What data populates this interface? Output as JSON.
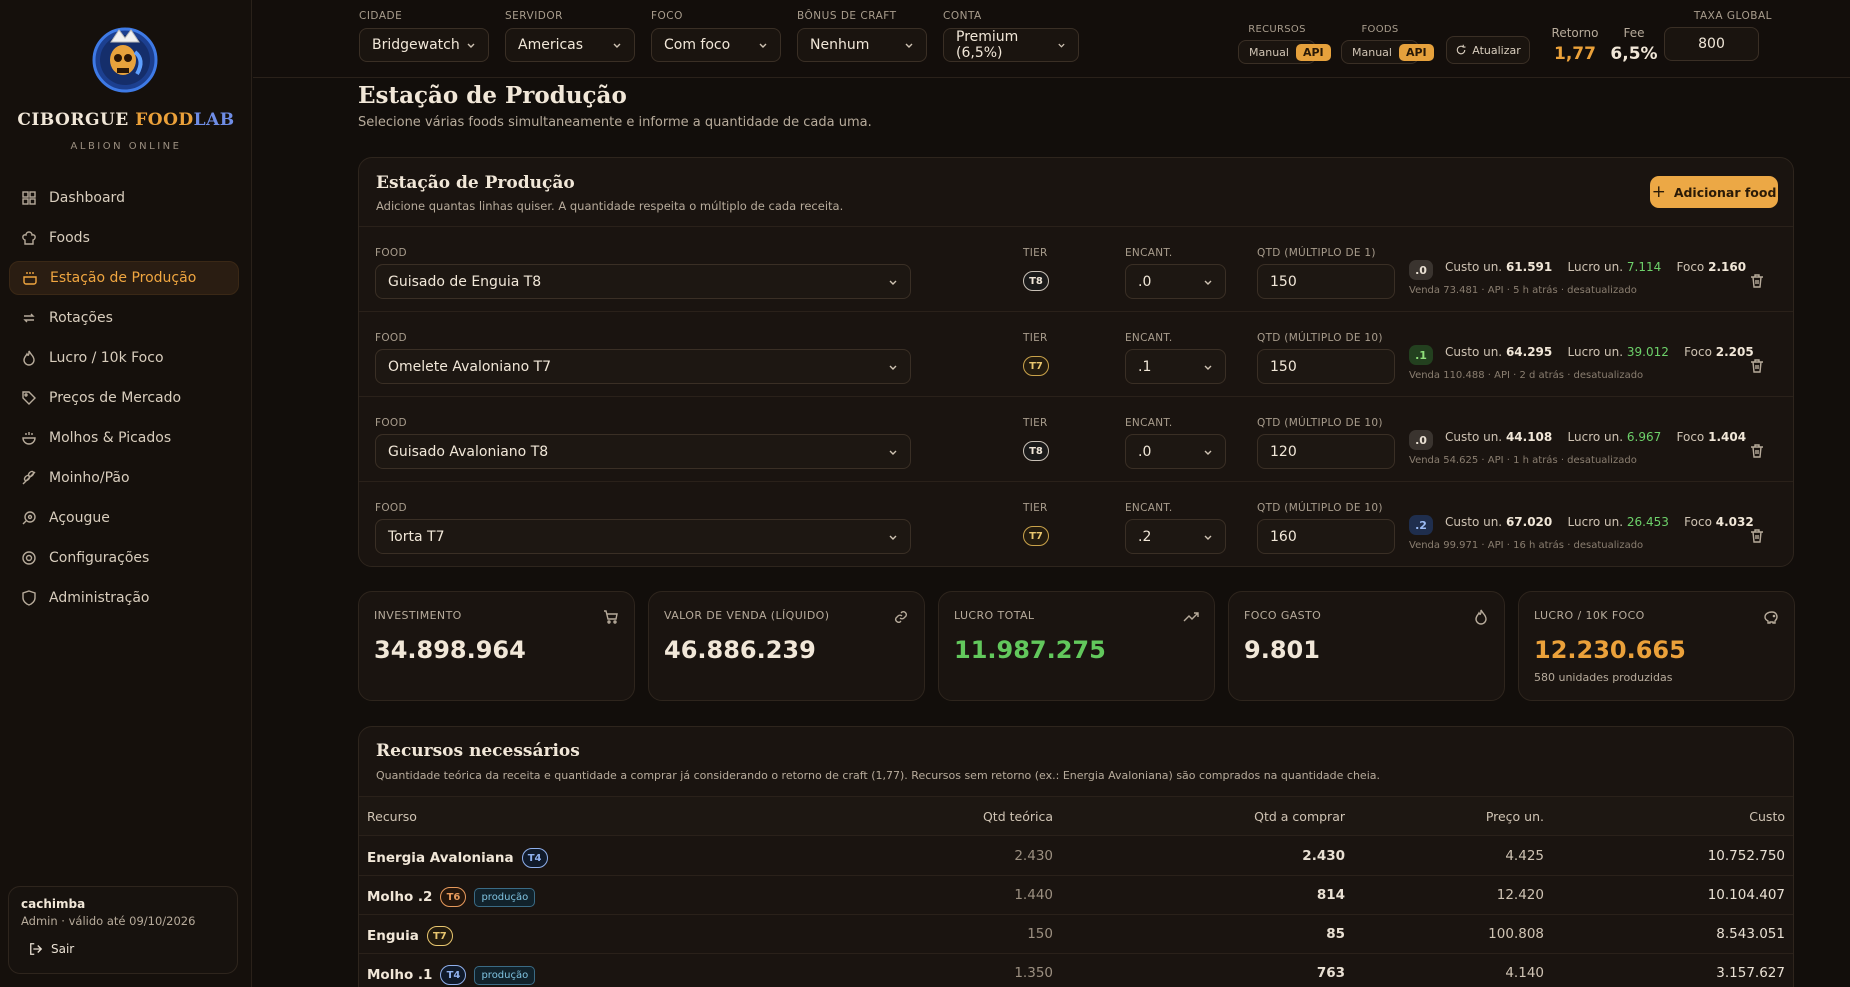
{
  "brand": {
    "name_a": "CIBORGUE ",
    "name_b": "FOOD",
    "name_c": "LAB",
    "sub": "ALBION ONLINE"
  },
  "nav": [
    {
      "label": "Dashboard",
      "icon": "grid-icon"
    },
    {
      "label": "Foods",
      "icon": "chef-hat-icon"
    },
    {
      "label": "Estação de Produção",
      "icon": "cooking-pot-icon",
      "active": true
    },
    {
      "label": "Rotações",
      "icon": "repeat-icon"
    },
    {
      "label": "Lucro / 10k Foco",
      "icon": "flame-icon"
    },
    {
      "label": "Preços de Mercado",
      "icon": "tag-icon"
    },
    {
      "label": "Molhos & Picados",
      "icon": "soup-icon"
    },
    {
      "label": "Moinho/Pão",
      "icon": "wheat-icon"
    },
    {
      "label": "Açougue",
      "icon": "beef-icon"
    },
    {
      "label": "Configurações",
      "icon": "settings-icon"
    },
    {
      "label": "Administração",
      "icon": "shield-icon"
    }
  ],
  "user": {
    "name": "cachimba",
    "role": "Admin · válido até 09/10/2026",
    "logout": "Sair"
  },
  "filters": {
    "cidade": {
      "label": "CIDADE",
      "value": "Bridgewatch"
    },
    "servidor": {
      "label": "SERVIDOR",
      "value": "Americas"
    },
    "foco": {
      "label": "FOCO",
      "value": "Com foco"
    },
    "bonus": {
      "label": "BÔNUS DE CRAFT",
      "value": "Nenhum"
    },
    "conta": {
      "label": "CONTA",
      "value": "Premium (6,5%)"
    }
  },
  "toggles": {
    "recursos": {
      "label": "RECURSOS",
      "manual": "Manual",
      "api": "API"
    },
    "foods": {
      "label": "FOODS",
      "manual": "Manual",
      "api": "API"
    }
  },
  "refresh_label": "Atualizar",
  "stats": {
    "retorno": {
      "label": "Retorno",
      "value": "1,77"
    },
    "fee": {
      "label": "Fee",
      "value": "6,5%"
    }
  },
  "taxa": {
    "label": "TAXA GLOBAL",
    "value": "800"
  },
  "page": {
    "title": "Estação de Produção",
    "subtitle": "Selecione várias foods simultaneamente e informe a quantidade de cada uma."
  },
  "station": {
    "title": "Estação de Produção",
    "subtitle": "Adicione quantas linhas quiser. A quantidade respeita o múltiplo de cada receita.",
    "add_label": "Adicionar food",
    "col_food": "FOOD",
    "col_tier": "TIER",
    "col_ench": "ENCANT.",
    "rows": [
      {
        "food": "Guisado de Enguia T8",
        "tier": "T8",
        "ench": ".0",
        "qtd_label": "QTD (MÚLTIPLO DE 1)",
        "qtd": "150",
        "chip": ".0",
        "custo_lbl": "Custo un.",
        "custo": "61.591",
        "lucro_lbl": "Lucro un.",
        "lucro": "7.114",
        "foco_lbl": "Foco",
        "foco": "2.160",
        "sub": "Venda 73.481 · API · 5 h atrás · desatualizado"
      },
      {
        "food": "Omelete Avaloniano T7",
        "tier": "T7",
        "ench": ".1",
        "qtd_label": "QTD (MÚLTIPLO DE 10)",
        "qtd": "150",
        "chip": ".1",
        "custo_lbl": "Custo un.",
        "custo": "64.295",
        "lucro_lbl": "Lucro un.",
        "lucro": "39.012",
        "foco_lbl": "Foco",
        "foco": "2.205",
        "sub": "Venda 110.488 · API · 2 d atrás · desatualizado"
      },
      {
        "food": "Guisado Avaloniano T8",
        "tier": "T8",
        "ench": ".0",
        "qtd_label": "QTD (MÚLTIPLO DE 10)",
        "qtd": "120",
        "chip": ".0",
        "custo_lbl": "Custo un.",
        "custo": "44.108",
        "lucro_lbl": "Lucro un.",
        "lucro": "6.967",
        "foco_lbl": "Foco",
        "foco": "1.404",
        "sub": "Venda 54.625 · API · 1 h atrás · desatualizado"
      },
      {
        "food": "Torta T7",
        "tier": "T7",
        "ench": ".2",
        "qtd_label": "QTD (MÚLTIPLO DE 10)",
        "qtd": "160",
        "chip": ".2",
        "custo_lbl": "Custo un.",
        "custo": "67.020",
        "lucro_lbl": "Lucro un.",
        "lucro": "26.453",
        "foco_lbl": "Foco",
        "foco": "4.032",
        "sub": "Venda 99.971 · API · 16 h atrás · desatualizado"
      }
    ]
  },
  "kpis": [
    {
      "label": "INVESTIMENTO",
      "value": "34.898.964",
      "icon": "cart-icon",
      "color": "#f1e7d8"
    },
    {
      "label": "VALOR DE VENDA (LÍQUIDO)",
      "value": "46.886.239",
      "icon": "link-icon",
      "color": "#f1e7d8"
    },
    {
      "label": "LUCRO TOTAL",
      "value": "11.987.275",
      "icon": "trending-up-icon",
      "color": "#62c85c"
    },
    {
      "label": "FOCO GASTO",
      "value": "9.801",
      "icon": "flame-icon",
      "color": "#f1e7d8"
    },
    {
      "label": "LUCRO / 10K FOCO",
      "value": "12.230.665",
      "icon": "piggy-bank-icon",
      "color": "#eba13a",
      "sub": "580 unidades produzidas"
    }
  ],
  "resources": {
    "title": "Recursos necessários",
    "subtitle": "Quantidade teórica da receita e quantidade a comprar já considerando o retorno de craft (1,77). Recursos sem retorno (ex.: Energia Avaloniana) são comprados na quantidade cheia.",
    "headers": {
      "recurso": "Recurso",
      "teorica": "Qtd teórica",
      "comprar": "Qtd a comprar",
      "preco": "Preço un.",
      "custo": "Custo"
    },
    "rows": [
      {
        "name": "Energia Avaloniana",
        "tier": "T4",
        "prod": "",
        "teorica": "2.430",
        "comprar": "2.430",
        "preco": "4.425",
        "custo": "10.752.750"
      },
      {
        "name": "Molho .2",
        "tier": "T6",
        "prod": "produção",
        "teorica": "1.440",
        "comprar": "814",
        "preco": "12.420",
        "custo": "10.104.407"
      },
      {
        "name": "Enguia",
        "tier": "T7",
        "prod": "",
        "teorica": "150",
        "comprar": "85",
        "preco": "100.808",
        "custo": "8.543.051"
      },
      {
        "name": "Molho .1",
        "tier": "T4",
        "prod": "produção",
        "teorica": "1.350",
        "comprar": "763",
        "preco": "4.140",
        "custo": "3.157.627"
      }
    ]
  }
}
